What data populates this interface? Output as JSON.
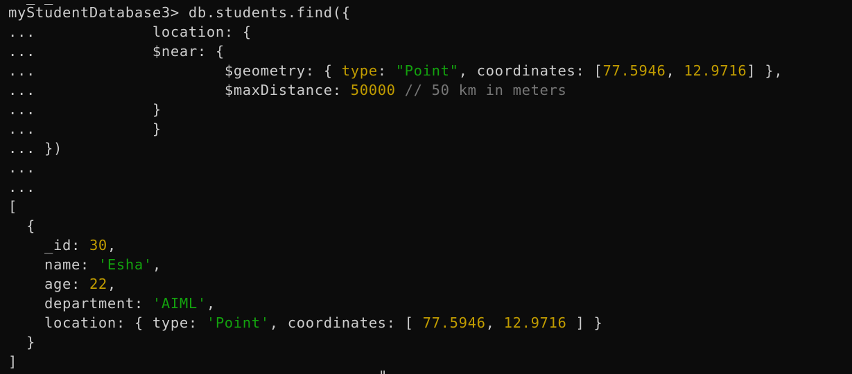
{
  "terminal": {
    "partial_top_text": "  _ _     ",
    "prompt": "myStudentDatabase3> ",
    "command": "db.students.find({",
    "continuation": "...",
    "query": {
      "location_line": "location: {",
      "near_line": "$near: {",
      "geometry_key": "$geometry: { ",
      "type_key": "type",
      "colon_space": ": ",
      "point_string": "\"Point\"",
      "coordinates_key": ", coordinates: [",
      "lon": "77.5946",
      "comma": ", ",
      "lat": "12.9716",
      "geometry_end": "] },",
      "max_key": "$maxDistance: ",
      "max_value": "50000",
      "comment": " // 50 km in meters",
      "close_brace": "}",
      "close_call": " })"
    },
    "result": {
      "open_bracket": "[",
      "open_brace": "  {",
      "id_key": "    _id: ",
      "id_value": "30",
      "name_key": "    name: ",
      "name_value": "'Esha'",
      "age_key": "    age: ",
      "age_value": "22",
      "department_key": "    department: ",
      "department_value": "'AIML'",
      "location_key": "    location: { type: ",
      "location_type": "'Point'",
      "coords_key": ", coordinates: [ ",
      "lon": "77.5946",
      "lat": "12.9716",
      "coords_end": " ] }",
      "close_brace": "  }",
      "close_bracket": "]",
      "trailing_comma": ","
    },
    "bottom_partial_text": "  \""
  },
  "colors": {
    "background": "#0c0c0c",
    "text": "#cccccc",
    "number": "#c19c00",
    "string": "#13a10e",
    "comment": "#767676"
  }
}
